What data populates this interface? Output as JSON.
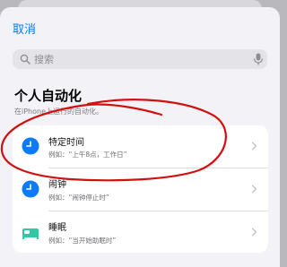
{
  "nav": {
    "cancel_label": "取消"
  },
  "search": {
    "placeholder": "搜索"
  },
  "section": {
    "title": "个人自动化",
    "subtitle": "在iPhone上运行的自动化。"
  },
  "triggers": [
    {
      "title": "特定时间",
      "subtitle": "例如：“上午8点，工作日”",
      "icon": "clock-icon"
    },
    {
      "title": "闹钟",
      "subtitle": "例如：“闹钟停止时”",
      "icon": "alarm-clock-icon"
    },
    {
      "title": "睡眠",
      "subtitle": "例如：“当开始助眠时”",
      "icon": "bed-icon"
    }
  ],
  "colors": {
    "accent": "#0a7aff",
    "sleep": "#34c7a6",
    "annotation": "#d21010"
  }
}
